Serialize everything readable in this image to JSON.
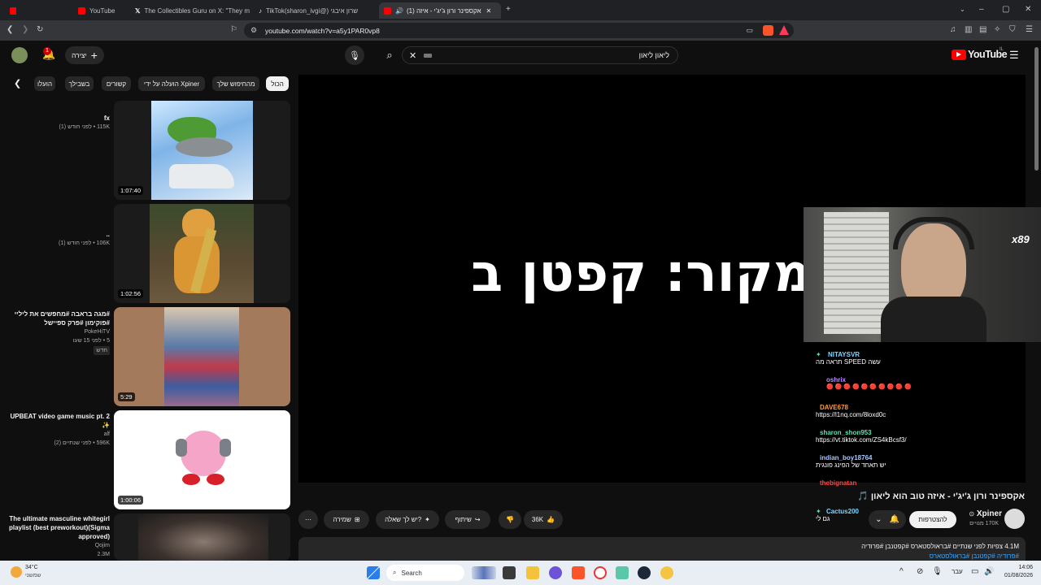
{
  "browser": {
    "tabs": [
      {
        "title": "YouTube",
        "favicon_color": "#ff0000"
      },
      {
        "title": "The Collectibles Guru on X: \"They m",
        "favicon_color": "#e8eaed"
      },
      {
        "title": "TikTok(sharon_ivgi@) שרון איבגי",
        "favicon_color": "#e8eaed"
      },
      {
        "title": "(1) אקספינר ורון ג'יג'י - איזה",
        "favicon_color": "#ff0000"
      }
    ],
    "url": "youtube.com/watch?v=a5y1PAR0vp8"
  },
  "masthead": {
    "create_label": "יצירה",
    "notification_count": "1",
    "search_value": "ליאון ליאון",
    "logo_text": "YouTube",
    "logo_suffix": "IL"
  },
  "chips": [
    "הכול",
    "מהחיפוש שלך",
    "הועלה על ידי Xpiner",
    "קשורים",
    "בשבילך",
    "הועלו"
  ],
  "related": [
    {
      "title": "fx",
      "meta": "115K • לפני חודש (1)",
      "duration": "1:07:40"
    },
    {
      "title": "..",
      "meta": "106K • לפני חודש (1)",
      "duration": "1:02:56"
    },
    {
      "title": "#מגה בראבה #מחפשים את ליליי #פוקימון #פרק ספיישל",
      "channel": "PokeHiTV",
      "meta": "5 • לפני 15 שעו",
      "badge": "חדש",
      "duration": "5:29"
    },
    {
      "title": "UPBEAT video game music pt. 2 ✨",
      "channel": "alf",
      "meta": "596K • לפני שנתיים (2)",
      "duration": "1:00:06"
    },
    {
      "title": "The ultimate masculine whitegirl playlist (best preworkout)(Sigma approved)",
      "channel": "Qojim",
      "meta": "2.3M",
      "duration": ""
    }
  ],
  "player": {
    "overlay_text": "מקור: קפטן בן",
    "webcam_badge": "x89"
  },
  "chat": [
    {
      "user": "NITAYSVR",
      "text": "עשה SPEED תראה מה",
      "color": "#7fd6ff"
    },
    {
      "user": "oshrix",
      "text": "🔴 🔴 🔴 🔴 🔴 🔴 🔴 🔴 🔴 🔴",
      "color": "#b58cff"
    },
    {
      "user": "DAVE678",
      "text": "https://l1nq.com/8loxd0c",
      "color": "#ff9b3d"
    },
    {
      "user": "sharon_shon953",
      "text": "https://vt.tiktok.com/ZS4kBcsf3/",
      "color": "#5fe0b0"
    },
    {
      "user": "indian_boy18764",
      "text": "יש תאחד של הפינג פונגית",
      "color": "#a4c8ff"
    },
    {
      "user": "thebignatan",
      "text": "",
      "color": "#ff4b4b"
    },
    {
      "user": "Cactus200",
      "text": "גם לי",
      "color": "#7fd6ff"
    }
  ],
  "video": {
    "title": "אקספינר ורון ג'יג'י - איזה טוב הוא ליאון 🎵",
    "channel": "Xpiner",
    "subscribers": "170K מנויים",
    "subscribe_label": "להצטרפות",
    "likes": "36K",
    "share_label": "שיתוף",
    "ask_label": "יש לך שאלה?",
    "save_label": "שמירה",
    "views": "4.1M צפיות  לפני שנתיים  #בראולסטארס #קפטנבן #פרודיה",
    "hashtags": "#פרודיה #קפטנבן #בראולסטארס"
  },
  "taskbar": {
    "weather_temp": "34°C",
    "weather_desc": "שמשני",
    "search_label": "Search",
    "lang": "עבר",
    "time": "14:06",
    "date": "01/08/2026"
  }
}
